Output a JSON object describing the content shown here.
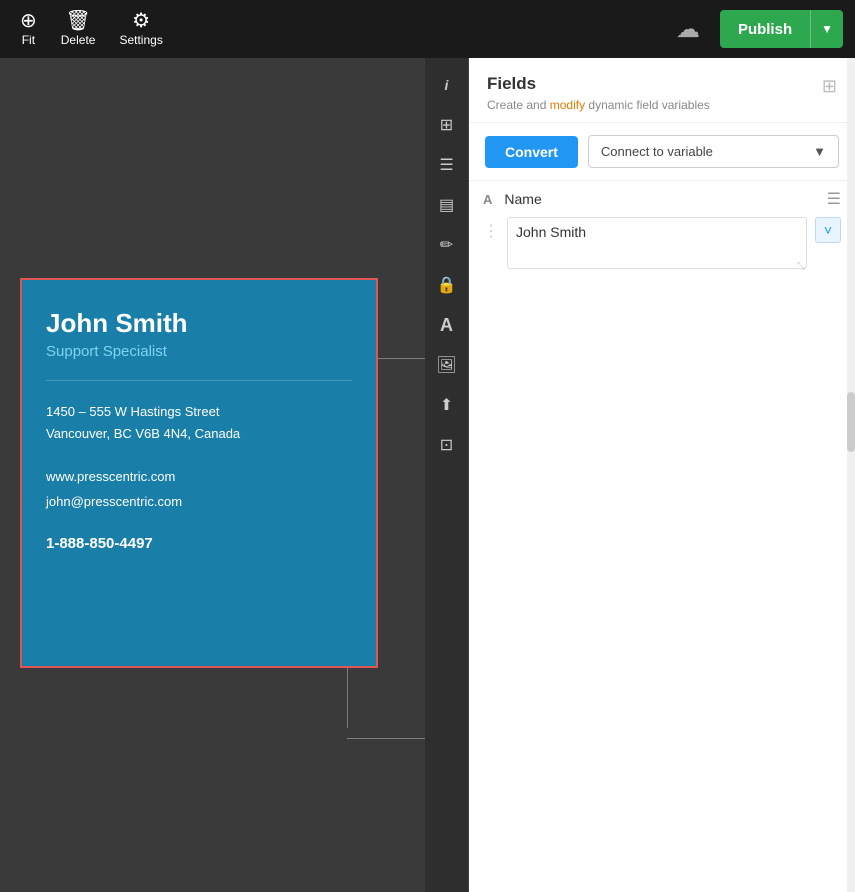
{
  "toolbar": {
    "fit_label": "Fit",
    "delete_label": "Delete",
    "settings_label": "Settings",
    "publish_label": "Publish"
  },
  "sidebar": {
    "icons": [
      {
        "name": "info-icon",
        "symbol": "i",
        "title": "Info"
      },
      {
        "name": "grid-icon",
        "symbol": "⊞",
        "title": "Grid"
      },
      {
        "name": "layers-icon",
        "symbol": "≡",
        "title": "Layers"
      },
      {
        "name": "text-icon",
        "symbol": "≡",
        "title": "Text"
      },
      {
        "name": "edit-icon",
        "symbol": "✎",
        "title": "Edit"
      },
      {
        "name": "lock-icon",
        "symbol": "🔒",
        "title": "Lock"
      },
      {
        "name": "font-icon",
        "symbol": "A",
        "title": "Font"
      },
      {
        "name": "image-icon",
        "symbol": "🖼",
        "title": "Image"
      },
      {
        "name": "upload-icon",
        "symbol": "⬆",
        "title": "Upload"
      },
      {
        "name": "share-icon",
        "symbol": "⊡",
        "title": "Share"
      }
    ]
  },
  "fields_panel": {
    "title": "Fields",
    "subtitle_static": "Create and modify dynamic field variables",
    "subtitle_link": "modify",
    "convert_label": "Convert",
    "connect_variable_label": "Connect to variable",
    "field_type": "A",
    "field_name": "Name",
    "field_value": "John Smith",
    "field_menu_symbol": "≡",
    "field_drag_symbol": "⋮",
    "field_expand_symbol": "˅",
    "field_resize_symbol": "⤡"
  },
  "business_card": {
    "name": "John Smith",
    "title": "Support Specialist",
    "address_line1": "1450 – 555 W Hastings Street",
    "address_line2": "Vancouver, BC V6B 4N4, Canada",
    "website": "www.presscentric.com",
    "email": "john@presscentric.com",
    "phone": "1-888-850-4497"
  }
}
